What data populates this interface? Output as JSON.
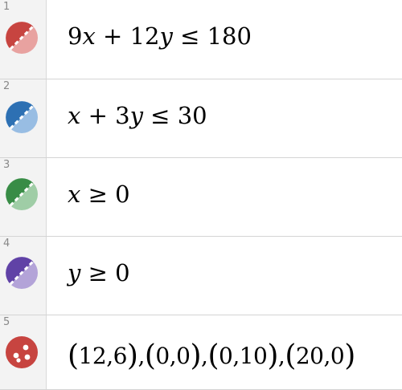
{
  "expressions": [
    {
      "index": "1",
      "icon": "inequality-style-red-icon",
      "color": "#c74440",
      "parts": {
        "a": "9",
        "v1": "x",
        "op": "+",
        "b": "12",
        "v2": "y",
        "rel": "≤",
        "c": "180"
      }
    },
    {
      "index": "2",
      "icon": "inequality-style-blue-icon",
      "color": "#2d70b3",
      "parts": {
        "v1": "x",
        "op": "+",
        "b": "3",
        "v2": "y",
        "rel": "≤",
        "c": "30"
      }
    },
    {
      "index": "3",
      "icon": "inequality-style-green-icon",
      "color": "#388c46",
      "parts": {
        "v": "x",
        "rel": "≥",
        "c": "0"
      }
    },
    {
      "index": "4",
      "icon": "inequality-style-purple-icon",
      "color": "#6042a6",
      "parts": {
        "v": "y",
        "rel": "≥",
        "c": "0"
      }
    },
    {
      "index": "5",
      "icon": "points-style-red-icon",
      "color": "#c74440",
      "points": [
        {
          "open": "(",
          "x": "12",
          "sep": ",",
          "y": "6",
          "close": ")"
        },
        {
          "open": "(",
          "x": "0",
          "sep": ",",
          "y": "0",
          "close": ")"
        },
        {
          "open": "(",
          "x": "0",
          "sep": ",",
          "y": "10",
          "close": ")"
        },
        {
          "open": "(",
          "x": "20",
          "sep": ",",
          "y": "0",
          "close": ")"
        }
      ],
      "list_sep": ","
    }
  ]
}
